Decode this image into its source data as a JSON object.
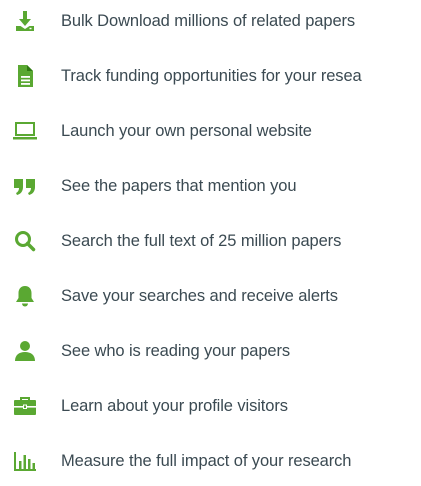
{
  "accent_color": "#5aa832",
  "features": [
    {
      "icon": "download-icon",
      "label": "Bulk Download millions of related papers"
    },
    {
      "icon": "document-icon",
      "label": "Track funding opportunities for your resea"
    },
    {
      "icon": "laptop-icon",
      "label": "Launch your own personal website"
    },
    {
      "icon": "quote-icon",
      "label": "See the papers that mention you"
    },
    {
      "icon": "search-icon",
      "label": "Search the full text of 25 million papers"
    },
    {
      "icon": "bell-icon",
      "label": "Save your searches and receive alerts"
    },
    {
      "icon": "user-icon",
      "label": "See who is reading your papers"
    },
    {
      "icon": "briefcase-icon",
      "label": "Learn about your profile visitors"
    },
    {
      "icon": "bar-chart-icon",
      "label": "Measure the full impact of your research"
    }
  ]
}
